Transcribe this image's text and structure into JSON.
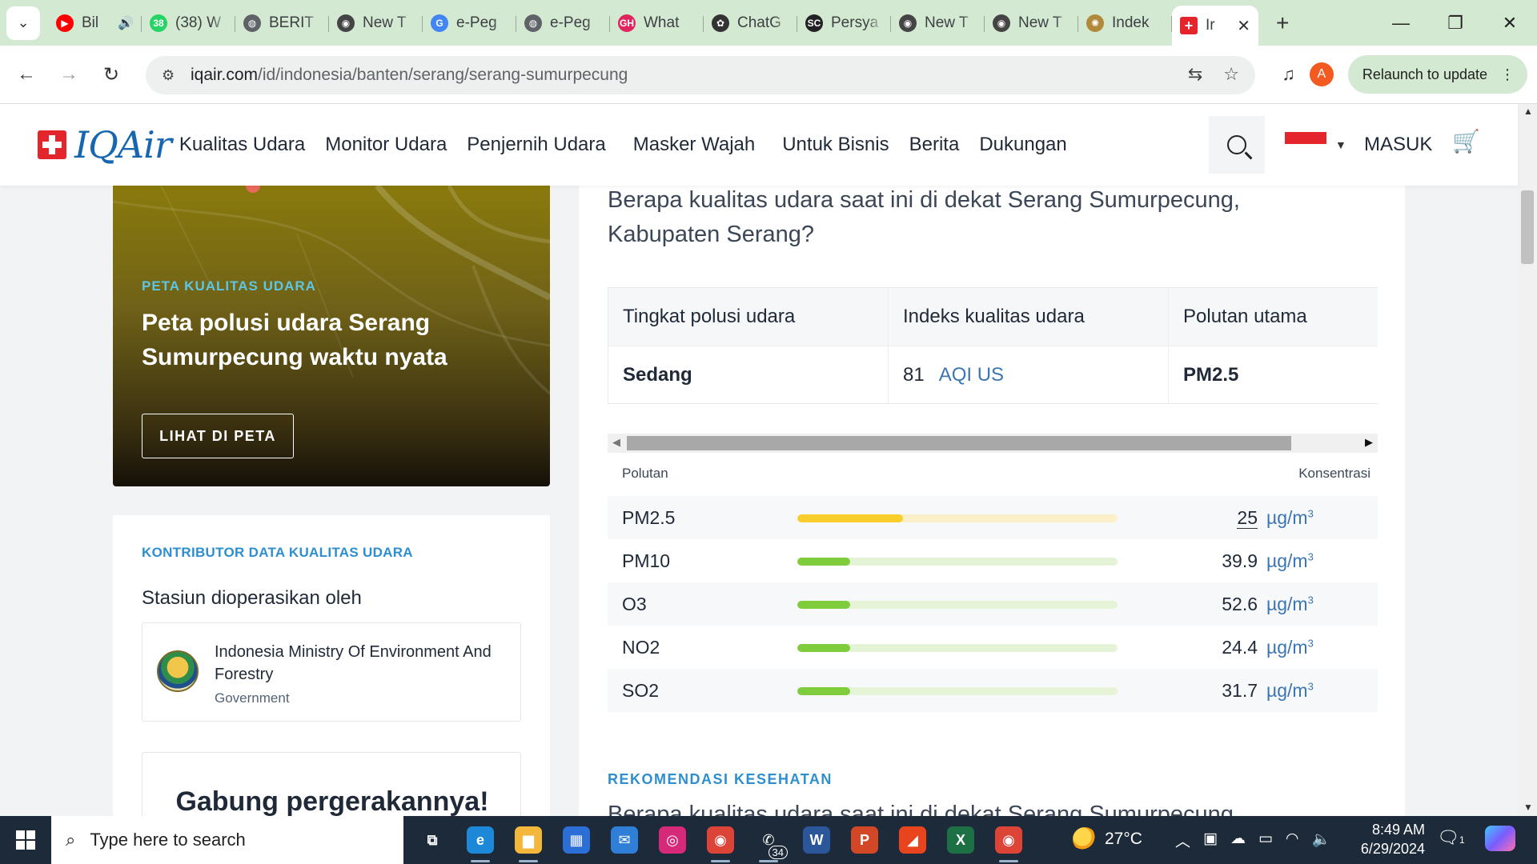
{
  "browser": {
    "tabs": [
      {
        "title": "Bil",
        "favicon": "youtube-icon",
        "color": "#ff0000",
        "glyph": "▶"
      },
      {
        "title": "(38) W",
        "favicon": "whatsapp-icon",
        "color": "#25d366",
        "glyph": "38"
      },
      {
        "title": "BERIT",
        "favicon": "globe-icon",
        "color": "#5f6368",
        "glyph": "◍"
      },
      {
        "title": "New T",
        "favicon": "chrome-icon",
        "color": "#444444",
        "glyph": "◉"
      },
      {
        "title": "e-Peg",
        "favicon": "google-icon",
        "color": "#4285f4",
        "glyph": "G"
      },
      {
        "title": "e-Peg",
        "favicon": "globe-icon",
        "color": "#5f6368",
        "glyph": "◍"
      },
      {
        "title": "What",
        "favicon": "gh-icon",
        "color": "#e0245e",
        "glyph": "GH"
      },
      {
        "title": "ChatG",
        "favicon": "chatgpt-icon",
        "color": "#333333",
        "glyph": "✿"
      },
      {
        "title": "Persya",
        "favicon": "sc-icon",
        "color": "#222222",
        "glyph": "SC"
      },
      {
        "title": "New T",
        "favicon": "chrome-icon",
        "color": "#444444",
        "glyph": "◉"
      },
      {
        "title": "New T",
        "favicon": "chrome-icon",
        "color": "#444444",
        "glyph": "◉"
      },
      {
        "title": "Indek",
        "favicon": "emblem-icon",
        "color": "#b08a3a",
        "glyph": "✺"
      }
    ],
    "active_tab": {
      "title": "Ir",
      "favicon": "iqair-icon",
      "color": "#e4262c"
    },
    "url_host": "iqair.com",
    "url_path": "/id/indonesia/banten/serang/serang-sumurpecung",
    "profile_initial": "A",
    "relaunch_label": "Relaunch to update"
  },
  "site": {
    "logo_text": "IQAir",
    "nav": [
      "Kualitas Udara",
      "Monitor Udara",
      "Penjernih Udara",
      "Masker Wajah",
      "Untuk Bisnis",
      "Berita",
      "Dukungan"
    ],
    "login": "MASUK"
  },
  "map_card": {
    "eyebrow": "PETA KUALITAS UDARA",
    "title": "Peta polusi udara Serang Sumurpecung waktu nyata",
    "button": "LIHAT DI PETA"
  },
  "contributor": {
    "eyebrow": "KONTRIBUTOR DATA KUALITAS UDARA",
    "heading": "Stasiun dioperasikan oleh",
    "station_name": "Indonesia Ministry Of Environment And Forestry",
    "station_type": "Government",
    "join_heading": "Gabung pergerakannya!"
  },
  "main": {
    "question": "Berapa kualitas udara saat ini di dekat Serang Sumurpecung, Kabupaten Serang?",
    "summary_headers": [
      "Tingkat polusi udara",
      "Indeks kualitas udara",
      "Polutan utama"
    ],
    "level": "Sedang",
    "aqi_value": "81",
    "aqi_unit": "AQI US",
    "main_pollutant": "PM2.5",
    "pollutant_header": "Polutan",
    "concentration_header": "Konsentrasi",
    "pollutants": [
      {
        "name": "PM2.5",
        "value": "25",
        "unit": "µg/m",
        "fill": 0.33,
        "color": "#f9cd2b",
        "track": "#fbf0c9"
      },
      {
        "name": "PM10",
        "value": "39.9",
        "unit": "µg/m",
        "fill": 0.165,
        "color": "#7fcd3c",
        "track": "#e5f3d6"
      },
      {
        "name": "O3",
        "value": "52.6",
        "unit": "µg/m",
        "fill": 0.165,
        "color": "#7fcd3c",
        "track": "#e5f3d6"
      },
      {
        "name": "NO2",
        "value": "24.4",
        "unit": "µg/m",
        "fill": 0.165,
        "color": "#7fcd3c",
        "track": "#e5f3d6"
      },
      {
        "name": "SO2",
        "value": "31.7",
        "unit": "µg/m",
        "fill": 0.165,
        "color": "#7fcd3c",
        "track": "#e5f3d6"
      }
    ],
    "unit_sup": "3",
    "recommendation_eyebrow": "REKOMENDASI KESEHATAN",
    "question_repeat": "Berapa kualitas udara saat ini di dekat Serang Sumurpecung"
  },
  "taskbar": {
    "search_placeholder": "Type here to search",
    "apps": [
      {
        "name": "task-view",
        "glyph": "⧉",
        "bg": "transparent",
        "open": false
      },
      {
        "name": "edge",
        "glyph": "e",
        "bg": "#1e88d8",
        "open": true
      },
      {
        "name": "file-explorer",
        "glyph": "▆",
        "bg": "#f3b73b",
        "open": true
      },
      {
        "name": "microsoft-store",
        "glyph": "▦",
        "bg": "#2b6fd6",
        "open": false
      },
      {
        "name": "mail",
        "glyph": "✉",
        "bg": "#2f7fd8",
        "open": false
      },
      {
        "name": "instagram",
        "glyph": "◎",
        "bg": "#d6297a",
        "open": false
      },
      {
        "name": "chrome",
        "glyph": "◉",
        "bg": "#db4437",
        "open": true
      },
      {
        "name": "whatsapp",
        "glyph": "✆",
        "bg": "#1c2a3a",
        "open": true,
        "badge": "34"
      },
      {
        "name": "word",
        "glyph": "W",
        "bg": "#2b579a",
        "open": false
      },
      {
        "name": "powerpoint",
        "glyph": "P",
        "bg": "#d24726",
        "open": false
      },
      {
        "name": "office",
        "glyph": "◢",
        "bg": "#e8451f",
        "open": false
      },
      {
        "name": "excel",
        "glyph": "X",
        "bg": "#1d7044",
        "open": false
      },
      {
        "name": "chrome-profile",
        "glyph": "◉",
        "bg": "#db4437",
        "open": true
      }
    ],
    "temperature": "27°C",
    "time": "8:49 AM",
    "date": "6/29/2024",
    "notification_count": "1"
  }
}
